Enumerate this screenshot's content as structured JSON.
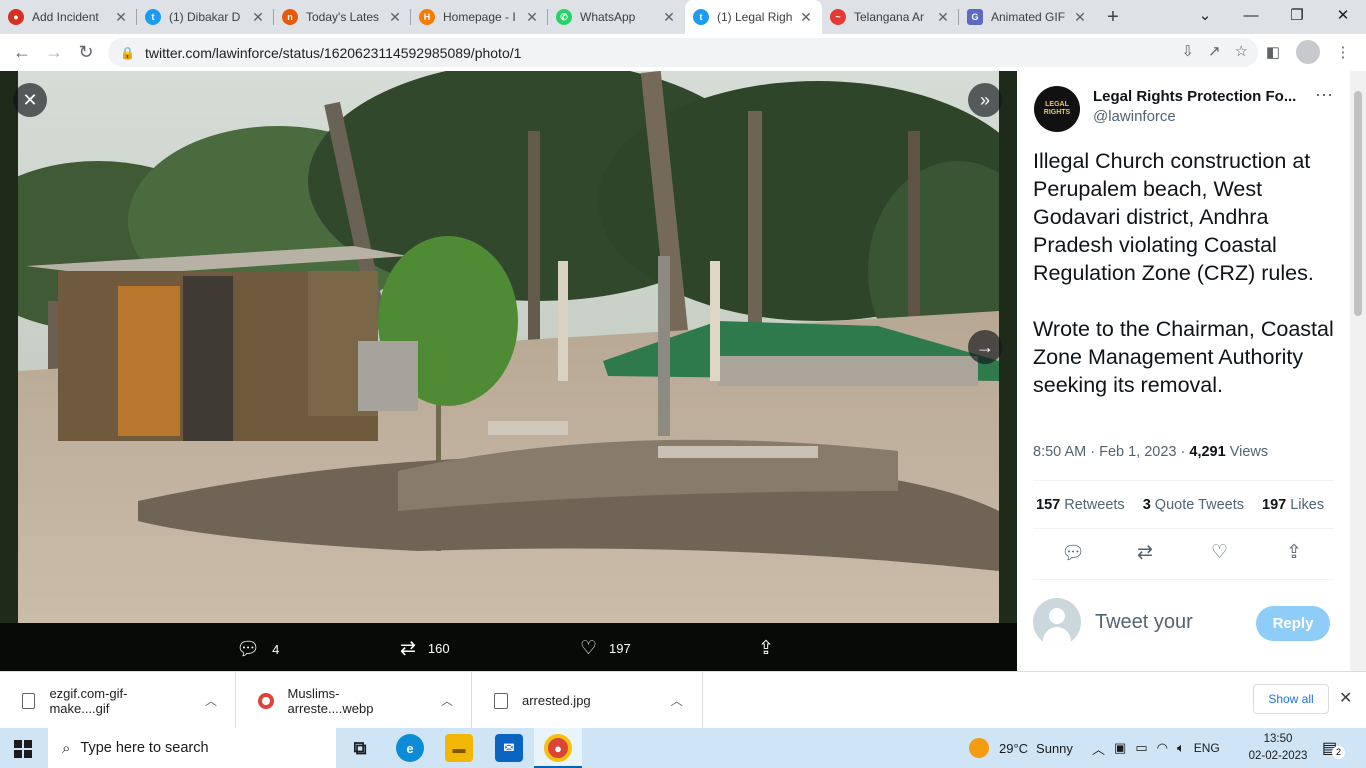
{
  "browser": {
    "tabs": [
      {
        "title": "Add Incident",
        "favicon_color": "#d93025",
        "icon": "flame-icon",
        "active": false
      },
      {
        "title": "(1) Dibakar D",
        "favicon_color": "#1d9bf0",
        "icon": "twitter-bird-icon",
        "active": false
      },
      {
        "title": "Today's Lates",
        "favicon_color": "#e8590c",
        "icon": "news-icon",
        "active": false
      },
      {
        "title": "Homepage - I",
        "favicon_color": "#f57c00",
        "icon": "hp-icon",
        "active": false
      },
      {
        "title": "WhatsApp",
        "favicon_color": "#25d366",
        "icon": "whatsapp-icon",
        "active": false
      },
      {
        "title": "(1) Legal Righ",
        "favicon_color": "#1d9bf0",
        "icon": "twitter-bird-icon",
        "active": true
      },
      {
        "title": "Telangana Ar",
        "favicon_color": "#e53935",
        "icon": "news-icon",
        "active": false
      },
      {
        "title": "Animated GIF",
        "favicon_color": "#5c6bc0",
        "icon": "gif-icon",
        "active": false
      }
    ],
    "url": "twitter.com/lawinforce/status/1620623114592985089/photo/1"
  },
  "viewer": {
    "actions": {
      "replies": "4",
      "retweets": "160",
      "likes": "197"
    }
  },
  "tweet": {
    "display_name": "Legal Rights Protection Fo...",
    "handle": "@lawinforce",
    "avatar_text": "LEGAL RIGHTS",
    "paragraph1": "Illegal Church construction at Perupalem beach, West Godavari district, Andhra Pradesh violating Coastal Regulation Zone (CRZ) rules.",
    "paragraph2": "Wrote to the Chairman, Coastal Zone Management Authority seeking its removal.",
    "timestamp": "8:50 AM · Feb 1, 2023 · ",
    "views_count": "4,291",
    "views_label": " Views",
    "retweets_count": "157",
    "retweets_label": " Retweets",
    "quote_count": "3",
    "quote_label": " Quote Tweets",
    "likes_count": "197",
    "likes_label": " Likes",
    "reply_placeholder": "Tweet your",
    "reply_button": "Reply"
  },
  "downloads": {
    "items": [
      {
        "name": "ezgif.com-gif-make....gif",
        "icon": "file-icon"
      },
      {
        "name": "Muslims-arreste....webp",
        "icon": "chrome-icon"
      },
      {
        "name": "arrested.jpg",
        "icon": "file-icon"
      }
    ],
    "show_all": "Show all"
  },
  "taskbar": {
    "search_placeholder": "Type here to search",
    "weather_temp": "29°C",
    "weather_text": "Sunny",
    "language": "ENG",
    "time": "13:50",
    "date": "02-02-2023",
    "notification_count": "2"
  }
}
